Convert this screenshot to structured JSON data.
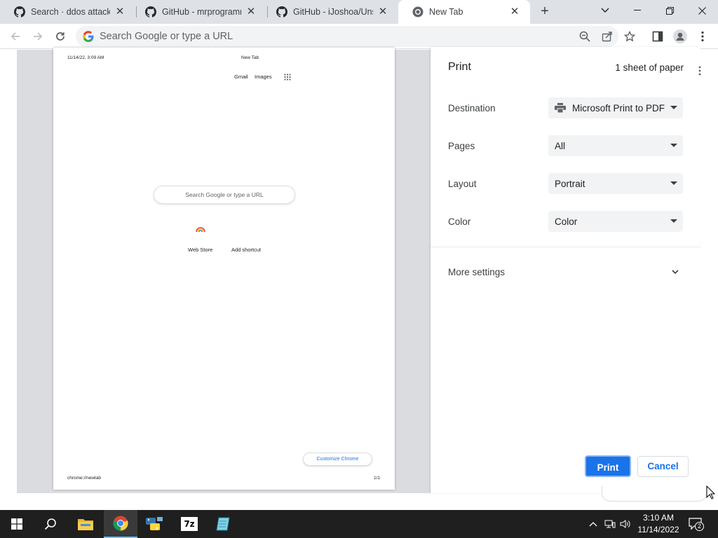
{
  "browser": {
    "tabs": [
      {
        "title": "Search · ddos attack · G",
        "icon": "github-icon",
        "active": false
      },
      {
        "title": "GitHub - mrprogramm",
        "icon": "github-icon",
        "active": false
      },
      {
        "title": "GitHub - iJoshoa/Unste",
        "icon": "github-icon",
        "active": false
      },
      {
        "title": "New Tab",
        "icon": "chrome-icon",
        "active": true
      }
    ],
    "new_tab_symbol": "+",
    "close_symbol": "✕",
    "omnibox_placeholder": "Search Google or type a URL"
  },
  "preview": {
    "header_left": "11/14/22, 3:09 AM",
    "header_center": "New Tab",
    "gmail": "Gmail",
    "images": "Images",
    "search_placeholder": "Search Google or type a URL",
    "shortcut_webstore": "Web Store",
    "shortcut_add": "Add shortcut",
    "customize": "Customize Chrome",
    "footer_left": "chrome://newtab",
    "footer_right": "1/1"
  },
  "print_panel": {
    "title": "Print",
    "sheets": "1 sheet of paper",
    "destination_label": "Destination",
    "destination_value": "Microsoft Print to PDF",
    "pages_label": "Pages",
    "pages_value": "All",
    "layout_label": "Layout",
    "layout_value": "Portrait",
    "color_label": "Color",
    "color_value": "Color",
    "more_settings": "More settings",
    "print_button": "Print",
    "cancel_button": "Cancel"
  },
  "taskbar": {
    "apps": [
      "start-icon",
      "search-icon",
      "file-explorer-icon",
      "chrome-icon",
      "python-icon",
      "7zip-icon",
      "notepad-icon"
    ],
    "time": "3:10 AM",
    "date": "11/14/2022",
    "notification_count": "2",
    "sevenzip_label": "7z"
  },
  "colors": {
    "accent": "#1a73e8",
    "taskbar": "#1f1f1f",
    "tabstrip": "#dee1e6"
  }
}
